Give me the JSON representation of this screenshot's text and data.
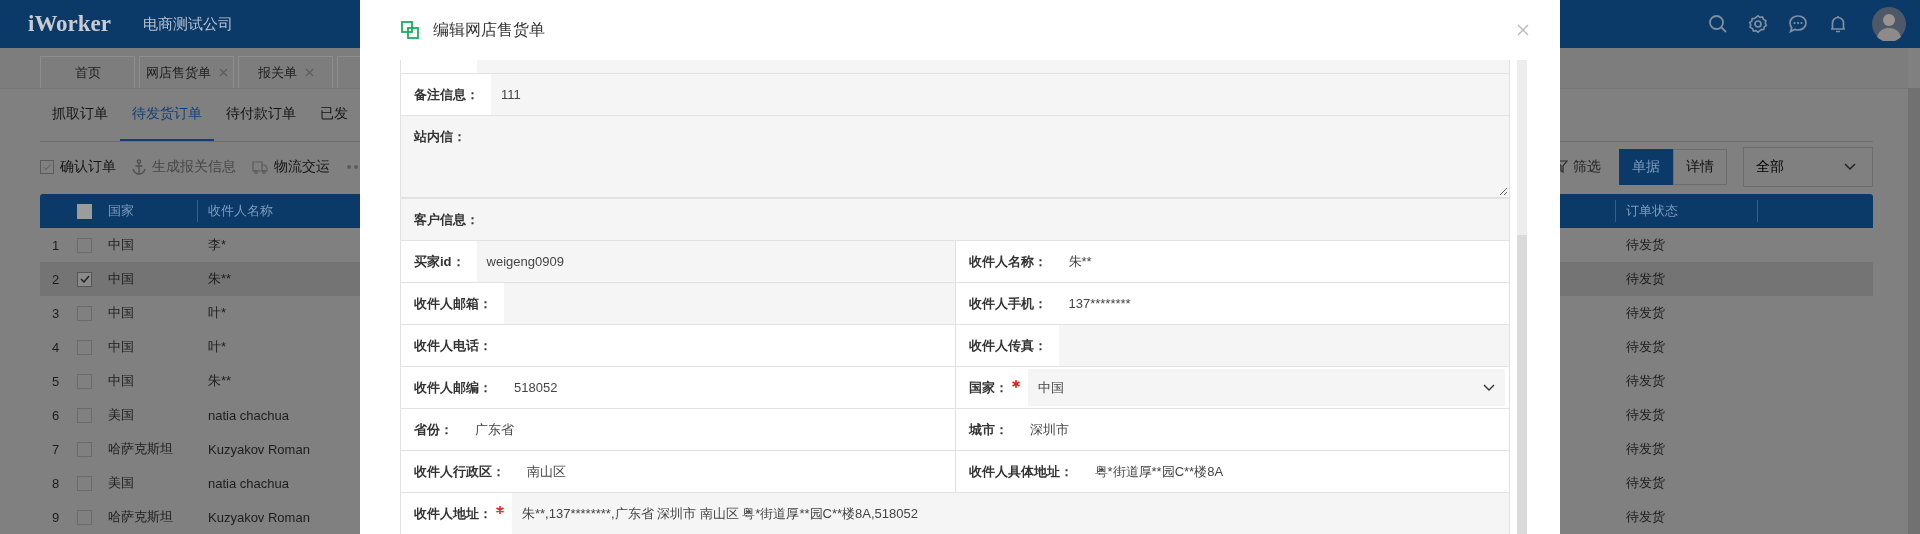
{
  "header": {
    "logo": "iWorker",
    "company": "电商测试公司"
  },
  "page_tabs": [
    {
      "label": "首页",
      "closable": false
    },
    {
      "label": "网店售货单",
      "closable": true
    },
    {
      "label": "报关单",
      "closable": true
    }
  ],
  "sub_tabs": [
    {
      "label": "抓取订单",
      "selected": false
    },
    {
      "label": "待发货订单",
      "selected": true
    },
    {
      "label": "待付款订单",
      "selected": false
    },
    {
      "label": "已发",
      "selected": false
    }
  ],
  "toolbar": [
    {
      "kind": "confirm",
      "label": "确认订单",
      "disabled": false
    },
    {
      "kind": "customs",
      "label": "生成报关信息",
      "disabled": true
    },
    {
      "kind": "shipping",
      "label": "物流交运",
      "disabled": false
    }
  ],
  "filter": {
    "label": "筛选"
  },
  "view_toggle": [
    {
      "label": "单据",
      "selected": true
    },
    {
      "label": "详情",
      "selected": false
    }
  ],
  "status_select": {
    "value": "全部"
  },
  "table": {
    "select_all": {
      "checked": false
    },
    "columns": [
      "国家",
      "收件人名称",
      "订单状态"
    ],
    "rows": [
      {
        "index": "1",
        "checked": false,
        "selected": false,
        "country": "中国",
        "name": "李*",
        "status": "待发货"
      },
      {
        "index": "2",
        "checked": true,
        "selected": true,
        "country": "中国",
        "name": "朱**",
        "status": "待发货"
      },
      {
        "index": "3",
        "checked": false,
        "selected": false,
        "country": "中国",
        "name": "叶*",
        "status": "待发货"
      },
      {
        "index": "4",
        "checked": false,
        "selected": false,
        "country": "中国",
        "name": "叶*",
        "status": "待发货"
      },
      {
        "index": "5",
        "checked": false,
        "selected": false,
        "country": "中国",
        "name": "朱**",
        "status": "待发货"
      },
      {
        "index": "6",
        "checked": false,
        "selected": false,
        "country": "美国",
        "name": "natia chachua",
        "status": "待发货"
      },
      {
        "index": "7",
        "checked": false,
        "selected": false,
        "country": "哈萨克斯坦",
        "name": "Kuzyakov Roman",
        "status": "待发货"
      },
      {
        "index": "8",
        "checked": false,
        "selected": false,
        "country": "美国",
        "name": "natia chachua",
        "status": "待发货"
      },
      {
        "index": "9",
        "checked": false,
        "selected": false,
        "country": "哈萨克斯坦",
        "name": "Kuzyakov Roman",
        "status": "待发货"
      }
    ]
  },
  "dialog": {
    "title": "编辑网店售货单",
    "form_rows": [
      {
        "cells": [
          {
            "kind": "input",
            "label": "备注信息：",
            "value": "111",
            "required": false
          }
        ]
      },
      {
        "cells": [
          {
            "kind": "textarea",
            "label": "站内信："
          }
        ]
      },
      {
        "cells": [
          {
            "kind": "section",
            "label": "客户信息："
          }
        ]
      },
      {
        "cells": [
          {
            "kind": "input",
            "label": "买家id：",
            "value": "weigeng0909",
            "required": false
          },
          {
            "kind": "text",
            "label": "收件人名称：",
            "value": "朱**",
            "required": false
          }
        ]
      },
      {
        "cells": [
          {
            "kind": "input",
            "label": "收件人邮箱：",
            "required": false
          },
          {
            "kind": "text",
            "label": "收件人手机：",
            "value": "137********",
            "required": false
          }
        ]
      },
      {
        "cells": [
          {
            "kind": "text",
            "label": "收件人电话：",
            "required": false
          },
          {
            "kind": "input",
            "label": "收件人传真：",
            "required": false
          }
        ]
      },
      {
        "cells": [
          {
            "kind": "text",
            "label": "收件人邮编：",
            "value": "518052",
            "required": false
          },
          {
            "kind": "select",
            "label": "国家：",
            "value": "中国",
            "required": true
          }
        ]
      },
      {
        "cells": [
          {
            "kind": "text",
            "label": "省份：",
            "value": "广东省",
            "required": false
          },
          {
            "kind": "text",
            "label": "城市：",
            "value": "深圳市",
            "required": false
          }
        ]
      },
      {
        "cells": [
          {
            "kind": "text",
            "label": "收件人行政区：",
            "value": "南山区",
            "required": false
          },
          {
            "kind": "text",
            "label": "收件人具体地址：",
            "value": "粤*街道厚**园C**楼8A",
            "required": false
          }
        ]
      },
      {
        "cells": [
          {
            "kind": "input",
            "label": "收件人地址：",
            "value": "朱**,137********,广东省 深圳市 南山区 粤*街道厚**园C**楼8A,518052",
            "required": true
          }
        ]
      }
    ]
  }
}
